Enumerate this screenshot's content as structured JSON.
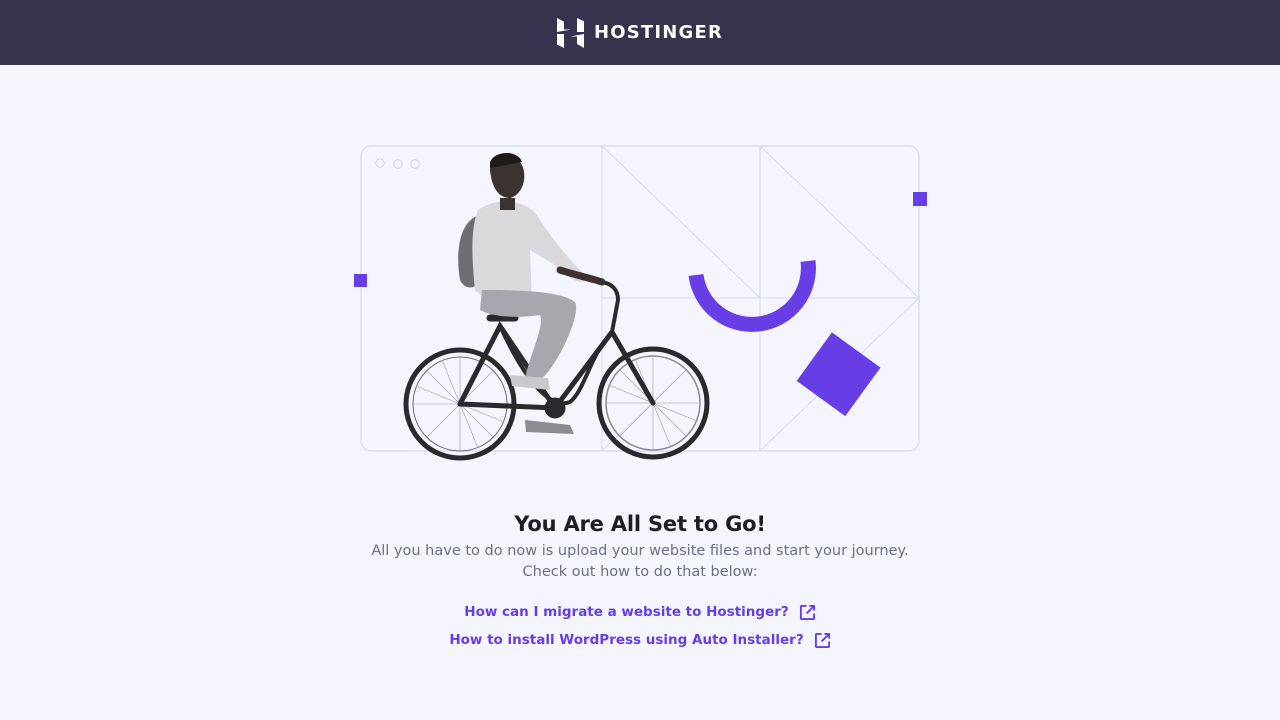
{
  "header": {
    "brand_name": "HOSTINGER",
    "logo_icon": "hostinger-logo-icon",
    "background_color": "#36344d"
  },
  "main": {
    "headline": "You Are All Set to Go!",
    "description_line1": "All you have to do now is upload your website files and start your journey.",
    "description_line2": "Check out how to do that below:",
    "links": [
      {
        "label": "How can I migrate a website to Hostinger?",
        "icon": "external-link-icon"
      },
      {
        "label": "How to install WordPress using Auto Installer?",
        "icon": "external-link-icon"
      }
    ]
  },
  "colors": {
    "page_background": "#f4f5ff",
    "accent": "#673de6",
    "heading": "#1d1e20",
    "body_text": "#6d7081"
  },
  "illustration": {
    "icon": "cyclist-illustration"
  }
}
